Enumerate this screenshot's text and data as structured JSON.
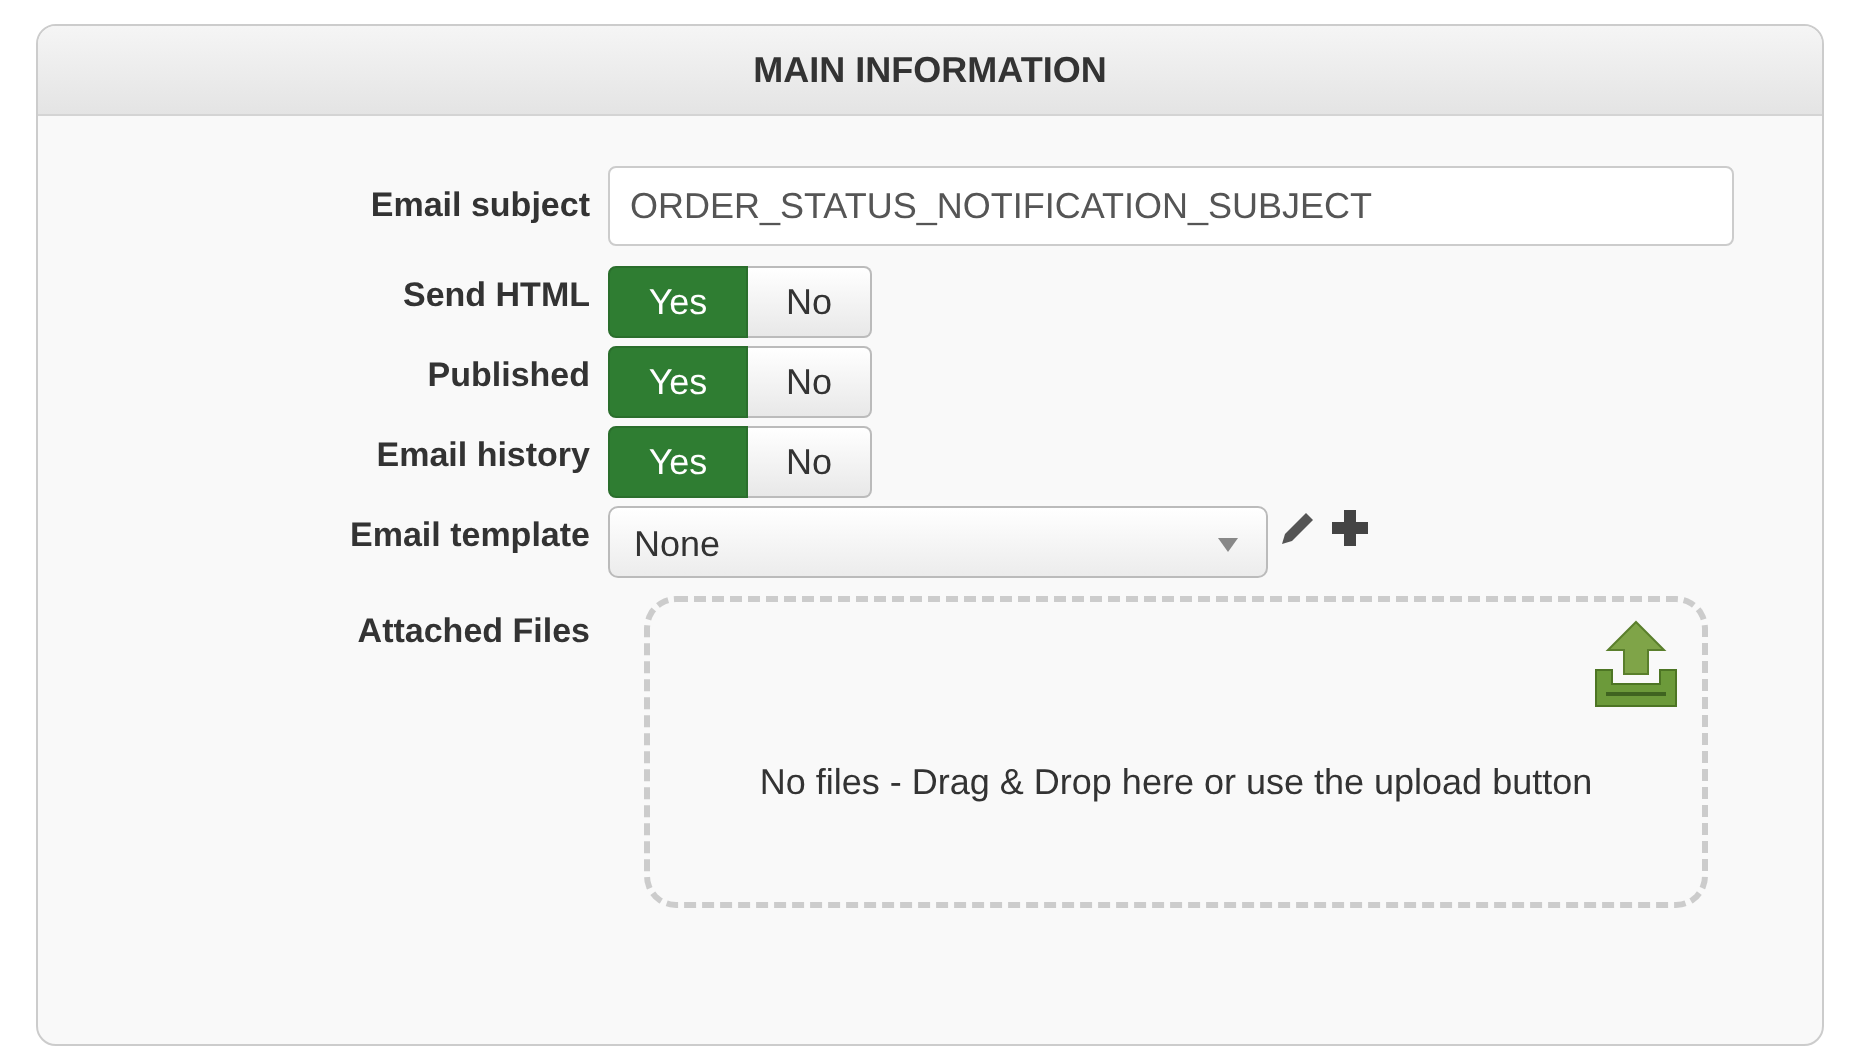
{
  "panel": {
    "title": "MAIN INFORMATION"
  },
  "fields": [
    {
      "kind": "text",
      "label": "Email subject",
      "value": "ORDER_STATUS_NOTIFICATION_SUBJECT"
    },
    {
      "kind": "toggle",
      "label": "Send HTML",
      "options": [
        {
          "label": "Yes",
          "selected": true
        },
        {
          "label": "No",
          "selected": false
        }
      ]
    },
    {
      "kind": "toggle",
      "label": "Published",
      "options": [
        {
          "label": "Yes",
          "selected": true
        },
        {
          "label": "No",
          "selected": false
        }
      ]
    },
    {
      "kind": "toggle",
      "label": "Email history",
      "options": [
        {
          "label": "Yes",
          "selected": true
        },
        {
          "label": "No",
          "selected": false
        }
      ]
    },
    {
      "kind": "select",
      "label": "Email template",
      "value": "None"
    },
    {
      "kind": "dropzone",
      "label": "Attached Files",
      "message": "No files - Drag & Drop here or use the upload button"
    }
  ]
}
